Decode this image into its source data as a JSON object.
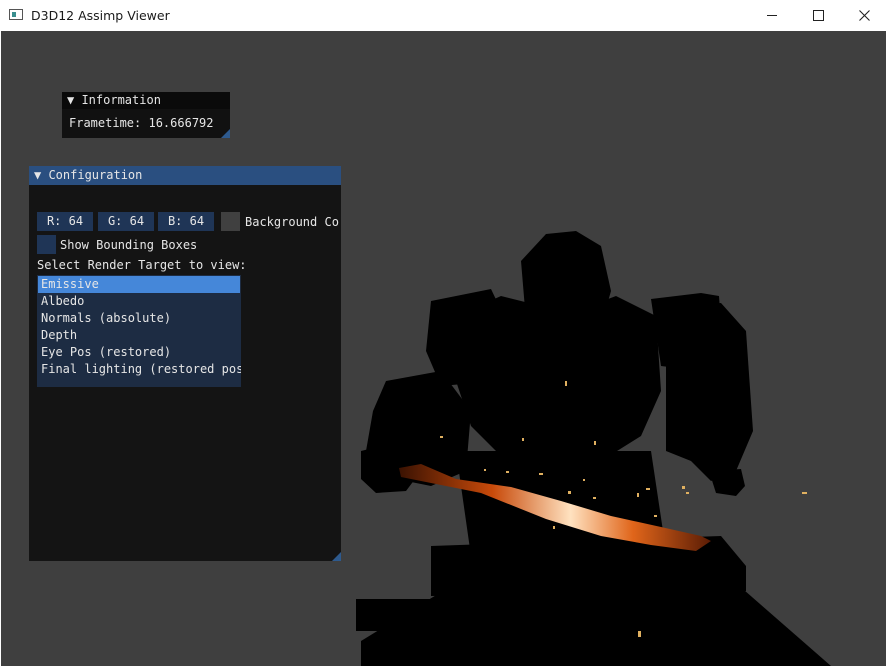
{
  "window": {
    "title": "D3D12 Assimp Viewer"
  },
  "info_panel": {
    "title": "▼ Information",
    "frametime_text": "Frametime: 16.666792"
  },
  "config_panel": {
    "title": "▼ Configuration",
    "r_value": "R: 64",
    "g_value": "G: 64",
    "b_value": "B: 64",
    "background_label": "Background Co",
    "bounding_boxes_label": "Show Bounding Boxes",
    "select_label": "Select Render Target to view:",
    "render_targets": [
      "Emissive",
      "Albedo",
      "Normals (absolute)",
      "Depth",
      "Eye Pos (restored)",
      "Final lighting (restored pos"
    ],
    "selected_index": 0
  },
  "colors": {
    "background": "#404040",
    "accent": "#4587d9",
    "title_active": "#2a4f80"
  }
}
